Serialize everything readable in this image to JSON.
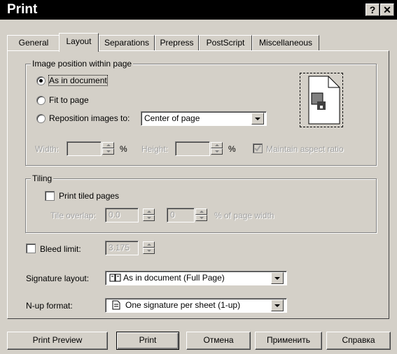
{
  "window": {
    "title": "Print",
    "help_label": "?",
    "close_label": "✕"
  },
  "tabs": [
    "General",
    "Layout",
    "Separations",
    "Prepress",
    "PostScript",
    "Miscellaneous"
  ],
  "image_position": {
    "legend": "Image position within page",
    "as_in_document": "As in document",
    "fit_to_page": "Fit to page",
    "reposition": "Reposition images to:",
    "reposition_value": "Center of page",
    "width_label": "Width:",
    "percent": "%",
    "height_label": "Height:",
    "maintain_aspect": "Maintain aspect ratio"
  },
  "tiling": {
    "legend": "Tiling",
    "print_tiled": "Print tiled pages",
    "tile_overlap_label": "Tile overlap:",
    "tile_overlap_value": "0.0",
    "page_width_value": "0",
    "page_width_label": "% of page width"
  },
  "bleed": {
    "label": "Bleed limit:",
    "value": "3.175"
  },
  "signature": {
    "label": "Signature layout:",
    "value": "As in document (Full Page)"
  },
  "nup": {
    "label": "N-up format:",
    "value": "One signature per sheet (1-up)"
  },
  "buttons": {
    "preview": "Print Preview",
    "print": "Print",
    "cancel": "Отмена",
    "apply": "Применить",
    "help": "Справка"
  }
}
